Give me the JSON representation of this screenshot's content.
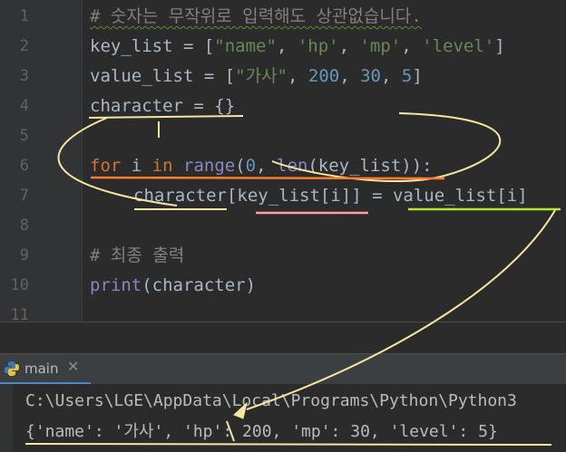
{
  "editor": {
    "line_numbers": [
      "1",
      "2",
      "3",
      "4",
      "5",
      "6",
      "7",
      "8",
      "9",
      "10",
      "11"
    ],
    "lines": {
      "l1": {
        "comment": "# 숫자는 무작위로 입력해도 상관없습니다."
      },
      "l2": {
        "p1": "key_list = [",
        "s1": "\"name\"",
        "p2": ", ",
        "s2": "'hp'",
        "p3": ", ",
        "s3": "'mp'",
        "p4": ", ",
        "s4": "'level'",
        "p5": "]"
      },
      "l3": {
        "p1": "value_list = [",
        "s1": "\"가사\"",
        "p2": ", ",
        "n1": "200",
        "p3": ", ",
        "n2": "30",
        "p4": ", ",
        "n3": "5",
        "p5": "]"
      },
      "l4": {
        "p1": "character = {}"
      },
      "l6": {
        "kw1": "for",
        "p1": " i ",
        "kw2": "in",
        "p2": " ",
        "b1": "range",
        "p3": "(",
        "n1": "0",
        "p4": ", ",
        "b2": "len",
        "p5": "(key_list)):"
      },
      "l7": {
        "p1": "character[key_list[i]] = value_list[i]"
      },
      "l9": {
        "comment": "# 최종 출력"
      },
      "l10": {
        "b1": "print",
        "p1": "(character)"
      }
    }
  },
  "run_panel": {
    "title": "main",
    "close": "✕",
    "output_path": "C:\\Users\\LGE\\AppData\\Local\\Programs\\Python\\Python3",
    "output_result": "{'name': '가사', 'hp': 200, 'mp': 30, 'level': 5}"
  },
  "colors": {
    "annotation_yellow": "#f5e7a1",
    "annotation_orange": "#ff7a2a",
    "annotation_pink": "#ff9aa8",
    "annotation_green": "#b6e63a"
  }
}
